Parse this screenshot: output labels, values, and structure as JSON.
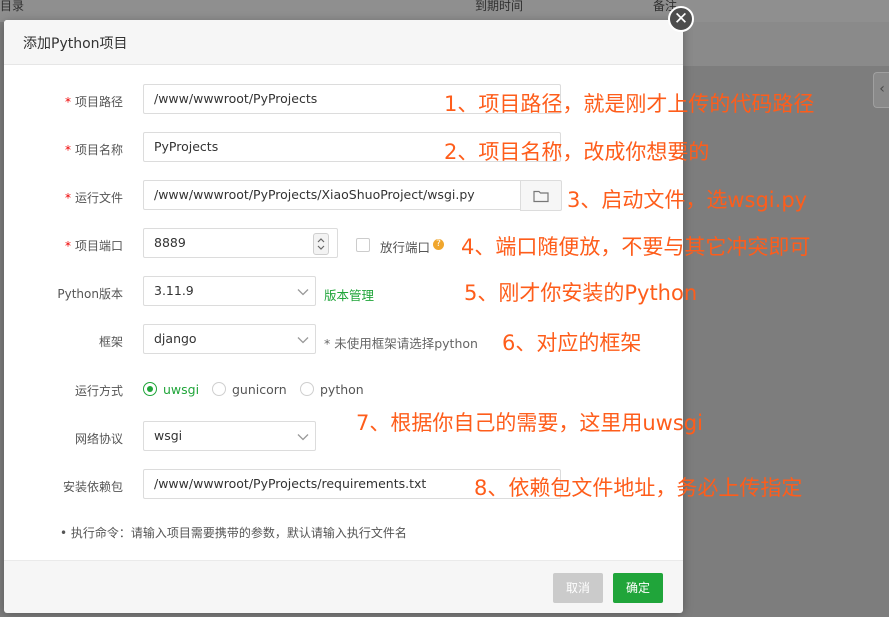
{
  "background": {
    "col_directory": "目录",
    "col_expire": "到期时间",
    "col_note": "备注",
    "side_arrow": "‹"
  },
  "dialog": {
    "title": "添加Python项目",
    "close_symbol": "✕"
  },
  "form": {
    "path": {
      "label": "项目路径",
      "required": "*",
      "value": "/www/wwwroot/PyProjects"
    },
    "name": {
      "label": "项目名称",
      "required": "*",
      "value": "PyProjects"
    },
    "run_file": {
      "label": "运行文件",
      "required": "*",
      "value": "/www/wwwroot/PyProjects/XiaoShuoProject/wsgi.py"
    },
    "port": {
      "label": "项目端口",
      "required": "*",
      "value": "8889",
      "open_port_label": "放行端口",
      "help": "?"
    },
    "python_version": {
      "label": "Python版本",
      "value": "3.11.9",
      "manage_link": "版本管理"
    },
    "framework": {
      "label": "框架",
      "value": "django",
      "note": "* 未使用框架请选择python"
    },
    "run_mode": {
      "label": "运行方式",
      "options": [
        {
          "label": "uwsgi",
          "selected": true
        },
        {
          "label": "gunicorn",
          "selected": false
        },
        {
          "label": "python",
          "selected": false
        }
      ]
    },
    "protocol": {
      "label": "网络协议",
      "value": "wsgi"
    },
    "requirements": {
      "label": "安装依赖包",
      "value": "/www/wwwroot/PyProjects/requirements.txt"
    },
    "exec_hint": "• 执行命令：请输入项目需要携带的参数，默认请输入执行文件名"
  },
  "annotations": {
    "a1": "1、项目路径，就是刚才上传的代码路径",
    "a2": "2、项目名称，改成你想要的",
    "a3": "3、启动文件，选wsgi.py",
    "a4": "4、端口随便放，不要与其它冲突即可",
    "a5": "5、刚才你安装的Python",
    "a6": "6、对应的框架",
    "a7": "7、根据你自己的需要，这里用uwsgi",
    "a8": "8、依赖包文件地址，务必上传指定"
  },
  "footer": {
    "cancel": "取消",
    "confirm": "确定"
  },
  "colors": {
    "accent_green": "#20a53a",
    "annotation_orange": "#fe5d1b",
    "required_red": "#ef0000"
  }
}
